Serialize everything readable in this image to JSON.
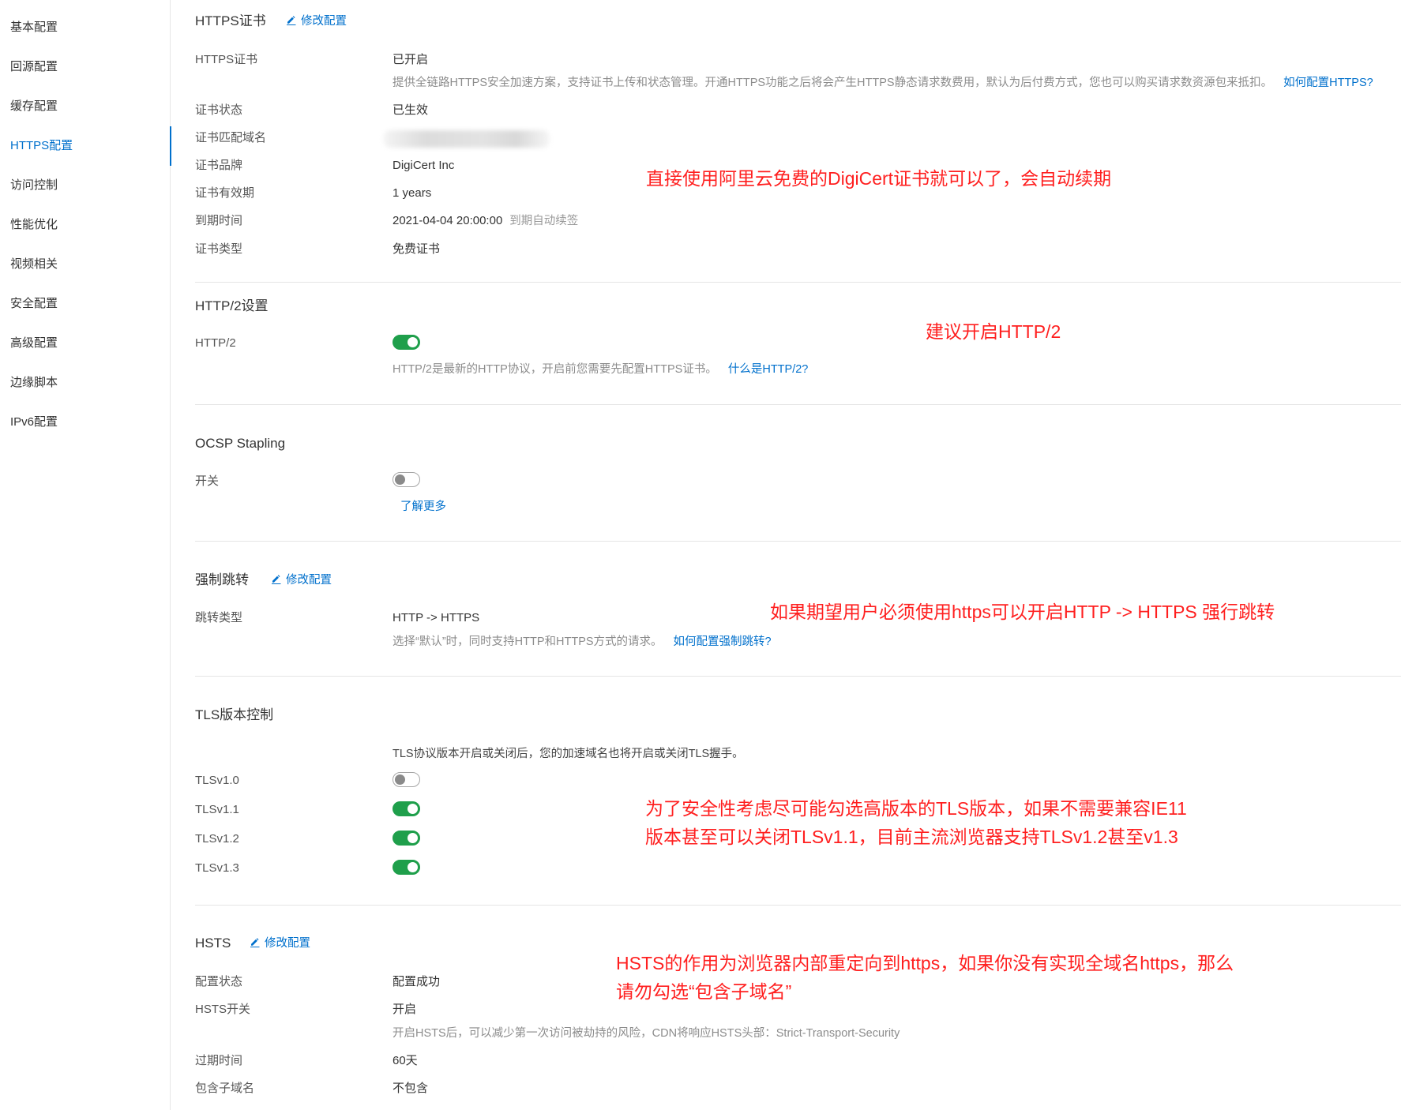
{
  "colors": {
    "accent": "#0070cc",
    "annotation": "#ff1f1f",
    "switch_on": "#1f9f4b"
  },
  "sidebar": {
    "items": [
      {
        "label": "基本配置"
      },
      {
        "label": "回源配置"
      },
      {
        "label": "缓存配置"
      },
      {
        "label": "HTTPS配置",
        "active": true
      },
      {
        "label": "访问控制"
      },
      {
        "label": "性能优化"
      },
      {
        "label": "视频相关"
      },
      {
        "label": "安全配置"
      },
      {
        "label": "高级配置"
      },
      {
        "label": "边缘脚本"
      },
      {
        "label": "IPv6配置"
      }
    ]
  },
  "https_cert": {
    "title": "HTTPS证书",
    "edit_icon": "pencil-edit-icon",
    "edit_label": "修改配置",
    "https": {
      "label": "HTTPS证书",
      "value": "已开启"
    },
    "description": "提供全链路HTTPS安全加速方案，支持证书上传和状态管理。开通HTTPS功能之后将会产生HTTPS静态请求数费用，默认为后付费方式，您也可以购买请求数资源包来抵扣。",
    "help_link": "如何配置HTTPS?",
    "status": {
      "label": "证书状态",
      "value": "已生效"
    },
    "domain": {
      "label": "证书匹配域名"
    },
    "brand": {
      "label": "证书品牌",
      "value": "DigiCert Inc"
    },
    "validity": {
      "label": "证书有效期",
      "value": "1 years"
    },
    "expiry": {
      "label": "到期时间",
      "value": "2021-04-04 20:00:00",
      "note": "到期自动续签"
    },
    "type": {
      "label": "证书类型",
      "value": "免费证书"
    }
  },
  "http2": {
    "title": "HTTP/2设置",
    "label": "HTTP/2",
    "enabled": true,
    "description": "HTTP/2是最新的HTTP协议，开启前您需要先配置HTTPS证书。",
    "help_link": "什么是HTTP/2?"
  },
  "ocsp": {
    "title": "OCSP Stapling",
    "label": "开关",
    "enabled": false,
    "learn_more": "了解更多"
  },
  "redirect": {
    "title": "强制跳转",
    "edit_icon": "pencil-edit-icon",
    "edit_label": "修改配置",
    "label": "跳转类型",
    "value": "HTTP -> HTTPS",
    "description": "选择“默认”时，同时支持HTTP和HTTPS方式的请求。",
    "help_link": "如何配置强制跳转?"
  },
  "tls": {
    "title": "TLS版本控制",
    "description": "TLS协议版本开启或关闭后，您的加速域名也将开启或关闭TLS握手。",
    "versions": [
      {
        "label": "TLSv1.0",
        "enabled": false
      },
      {
        "label": "TLSv1.1",
        "enabled": true
      },
      {
        "label": "TLSv1.2",
        "enabled": true
      },
      {
        "label": "TLSv1.3",
        "enabled": true
      }
    ]
  },
  "hsts": {
    "title": "HSTS",
    "edit_icon": "pencil-edit-icon",
    "edit_label": "修改配置",
    "config_status": {
      "label": "配置状态",
      "value": "配置成功"
    },
    "switch": {
      "label": "HSTS开关",
      "value": "开启"
    },
    "description": "开启HSTS后，可以减少第一次访问被劫持的风险，CDN将响应HSTS头部：Strict-Transport-Security",
    "max_age": {
      "label": "过期时间",
      "value": "60天"
    },
    "include_subdomains": {
      "label": "包含子域名",
      "value": "不包含"
    }
  },
  "annotations": {
    "https_cert": [
      "直接使用阿里云免费的DigiCert证书就可以了，会自动续期"
    ],
    "http2": [
      "建议开启HTTP/2"
    ],
    "redirect": [
      "如果期望用户必须使用https可以开启HTTP -> HTTPS 强行跳转"
    ],
    "tls": [
      "为了安全性考虑尽可能勾选高版本的TLS版本，如果不需要兼容IE11",
      "版本甚至可以关闭TLSv1.1，目前主流浏览器支持TLSv1.2甚至v1.3"
    ],
    "hsts": [
      "HSTS的作用为浏览器内部重定向到https，如果你没有实现全域名https，那么",
      "请勿勾选“包含子域名”"
    ]
  }
}
